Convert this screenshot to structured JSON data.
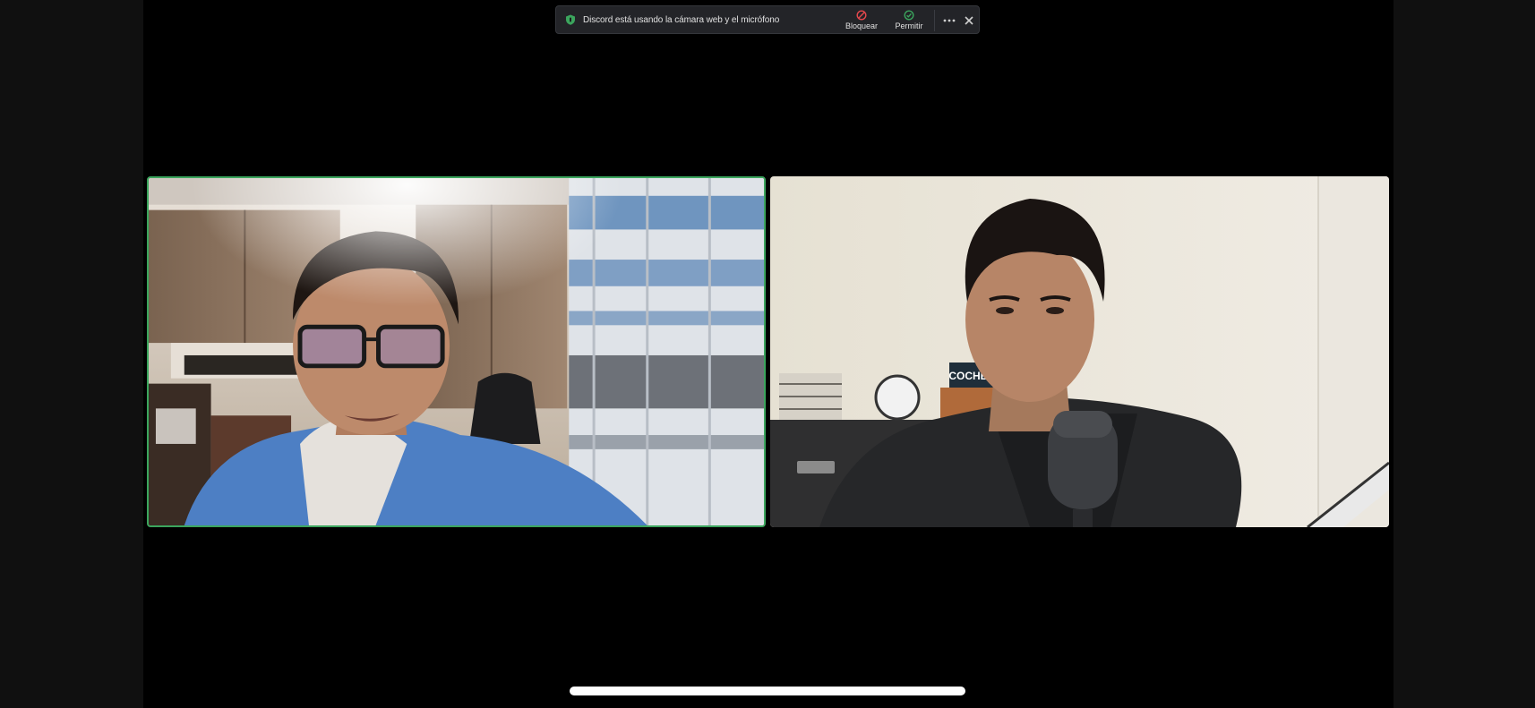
{
  "banner": {
    "message": "Discord está usando la cámara web y el micrófono",
    "block_label": "Bloquear",
    "allow_label": "Permitir"
  },
  "icons": {
    "shield": "shield-icon",
    "block": "block-icon",
    "allow": "check-circle-icon",
    "more": "more-horizontal-icon",
    "close": "close-icon"
  },
  "colors": {
    "speaking_border": "#3ba55d",
    "block_icon": "#e5484d",
    "allow_icon": "#3ba55d",
    "background": "#000000"
  },
  "right_tile": {
    "sign_text": "COCHES"
  }
}
